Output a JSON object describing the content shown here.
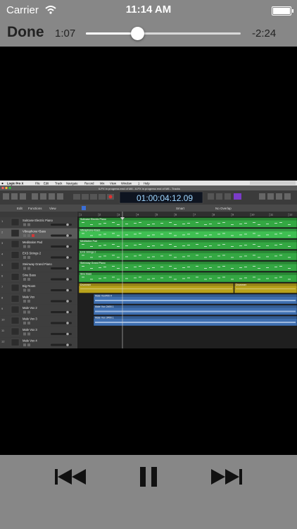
{
  "status_bar": {
    "carrier": "Carrier",
    "time": "11:14 AM"
  },
  "player": {
    "done_label": "Done",
    "elapsed": "1:07",
    "remaining": "-2:24",
    "progress": 0.33
  },
  "video": {
    "app_menu": [
      "Logic Pro X",
      "File",
      "Edit",
      "Track",
      "Navigate",
      "Record",
      "Mix",
      "View",
      "Window",
      "1",
      "Help"
    ],
    "window_title": "ILPX in progress end of M8 - ILPX in progress end of M8 - Tracks",
    "lcd_time": "01:00:04:12.09",
    "toolbar_labels": [
      "Edit",
      "Functions",
      "View"
    ],
    "snap": "Smart",
    "drag": "No Overlap",
    "tracks": [
      {
        "number": "1",
        "name": "Suitcase Electric Piano"
      },
      {
        "number": "2",
        "name": "Vibraphone+Bass"
      },
      {
        "number": "3",
        "name": "Meditation Pad"
      },
      {
        "number": "4",
        "name": "EXS Strings 2"
      },
      {
        "number": "5",
        "name": "Steinway Grand Piano"
      },
      {
        "number": "6",
        "name": "Sine Bass"
      },
      {
        "number": "7",
        "name": "Big Room"
      },
      {
        "number": "8",
        "name": "Male Vox"
      },
      {
        "number": "9",
        "name": "Male Vox 2"
      },
      {
        "number": "10",
        "name": "Male Vox 3"
      },
      {
        "number": "11",
        "name": "Male Vox 3"
      },
      {
        "number": "12",
        "name": "Male Vox 4"
      }
    ],
    "regions": {
      "r1": "Suitcase Electric Piano",
      "r2": "Vibraphone+Bass",
      "r3": "Meditation Pad",
      "r4": "EXS Strings 2",
      "r5": "Steinway Grand Piano",
      "r6": "Sine Bass",
      "r7a": "Drummer",
      "r7b": "Drummer",
      "r8": "Male Vox#00.4",
      "r9": "Male Vox 2#00.1",
      "r10": "Male Vox 3#00.1"
    },
    "ruler": [
      "1",
      "2",
      "3",
      "4",
      "5",
      "6",
      "7",
      "8",
      "9",
      "10",
      "11",
      "12"
    ]
  },
  "controls": {
    "prev_icon": "previous-track-icon",
    "pause_icon": "pause-icon",
    "next_icon": "next-track-icon"
  }
}
